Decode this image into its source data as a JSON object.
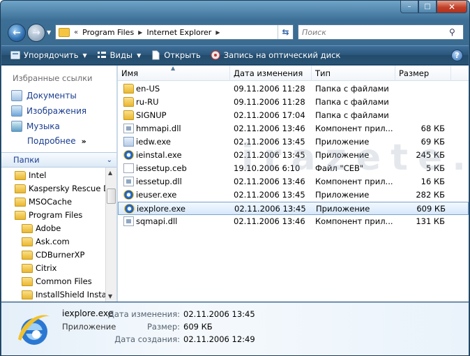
{
  "window": {
    "min_glyph": "–",
    "max_glyph": "□",
    "close_glyph": "✕"
  },
  "address": {
    "overflow": "«",
    "crumbs": [
      "Program Files",
      "Internet Explorer"
    ],
    "search_placeholder": "Поиск"
  },
  "toolbar": {
    "organize": "Упорядочить",
    "views": "Виды",
    "open": "Открыть",
    "burn": "Запись на оптический диск",
    "help": "?"
  },
  "favorites": {
    "header": "Избранные ссылки",
    "links": [
      "Документы",
      "Изображения",
      "Музыка"
    ],
    "more": "Подробнее"
  },
  "folders": {
    "header": "Папки",
    "items": [
      "Intel",
      "Kaspersky Rescue Di",
      "MSOCache",
      "Program Files",
      "Adobe",
      "Ask.com",
      "CDBurnerXP",
      "Citrix",
      "Common Files",
      "InstallShield Install"
    ]
  },
  "columns": {
    "name": "Имя",
    "date": "Дата изменения",
    "type": "Тип",
    "size": "Размер"
  },
  "files": [
    {
      "name": "en-US",
      "date": "09.11.2006 11:28",
      "type": "Папка с файлами",
      "size": "",
      "icon": "folder-icon"
    },
    {
      "name": "ru-RU",
      "date": "09.11.2006 11:28",
      "type": "Папка с файлами",
      "size": "",
      "icon": "folder-icon"
    },
    {
      "name": "SIGNUP",
      "date": "02.11.2006 17:04",
      "type": "Папка с файлами",
      "size": "",
      "icon": "folder-icon"
    },
    {
      "name": "hmmapi.dll",
      "date": "02.11.2006 13:46",
      "type": "Компонент прил...",
      "size": "68 КБ",
      "icon": "dll-file-icon"
    },
    {
      "name": "iedw.exe",
      "date": "02.11.2006 13:45",
      "type": "Приложение",
      "size": "69 КБ",
      "icon": "exe-file-icon"
    },
    {
      "name": "ieinstal.exe",
      "date": "02.11.2006 13:45",
      "type": "Приложение",
      "size": "245 КБ",
      "icon": "ie-icon"
    },
    {
      "name": "iessetup.ceb",
      "date": "19.10.2006 6:10",
      "type": "Файл \"CEB\"",
      "size": "5 КБ",
      "icon": "generic-file-icon"
    },
    {
      "name": "iessetup.dll",
      "date": "02.11.2006 13:46",
      "type": "Компонент прил...",
      "size": "16 КБ",
      "icon": "dll-file-icon"
    },
    {
      "name": "ieuser.exe",
      "date": "02.11.2006 13:45",
      "type": "Приложение",
      "size": "282 КБ",
      "icon": "ie-icon"
    },
    {
      "name": "iexplore.exe",
      "date": "02.11.2006 13:45",
      "type": "Приложение",
      "size": "609 КБ",
      "icon": "ie-icon",
      "selected": true
    },
    {
      "name": "sqmapi.dll",
      "date": "02.11.2006 13:46",
      "type": "Компонент прил...",
      "size": "131 КБ",
      "icon": "dll-file-icon"
    }
  ],
  "watermark": "irazete.ru",
  "details": {
    "name": "iexplore.exe",
    "type": "Приложение",
    "modified_label": "Дата изменения:",
    "modified_value": "02.11.2006 13:45",
    "size_label": "Размер:",
    "size_value": "609 КБ",
    "created_label": "Дата создания:",
    "created_value": "02.11.2006 12:49"
  },
  "colors": {
    "accent": "#1a3d8f",
    "selection": "#d6e8fb"
  }
}
